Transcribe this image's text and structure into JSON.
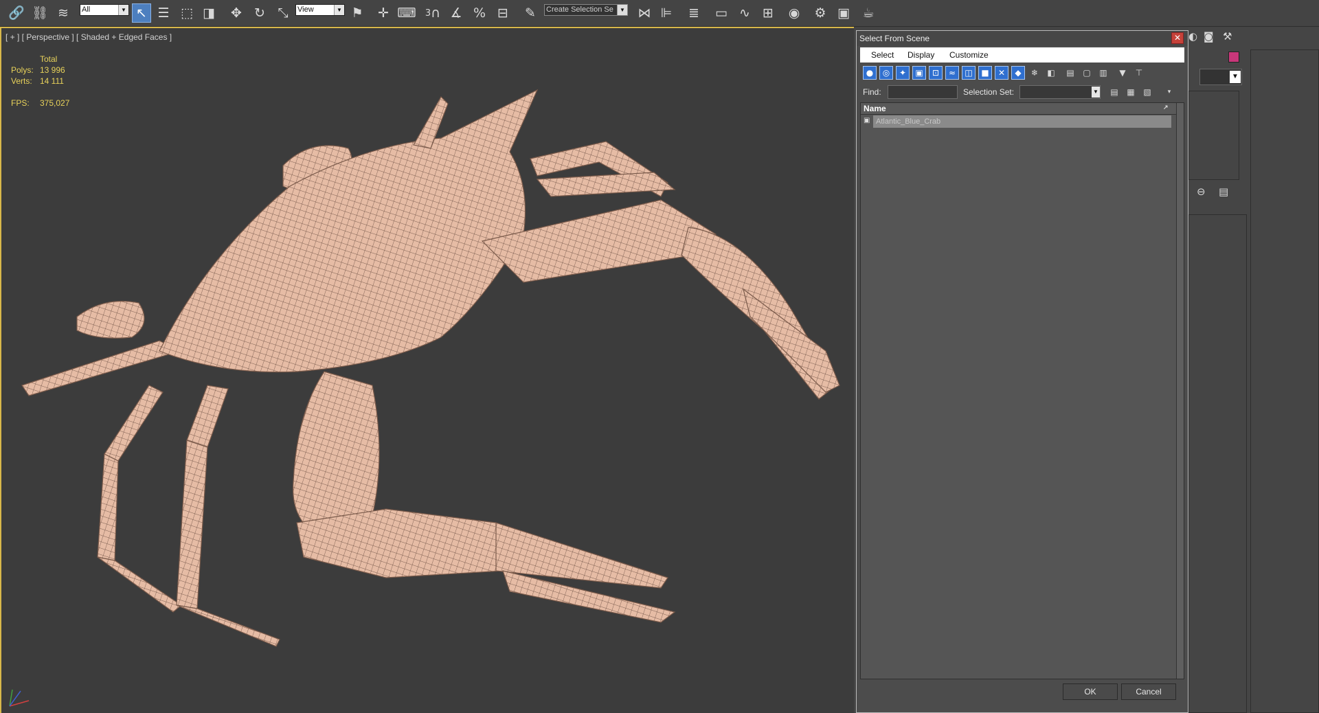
{
  "toolbar": {
    "selection_filter": "All",
    "reference_coord": "View",
    "named_selection_placeholder": "Create Selection Se",
    "snap_angle_label": "3",
    "icons": [
      "link-icon",
      "unlink-icon",
      "bind-space-warp-icon",
      "select-object-icon",
      "select-by-name-icon",
      "rect-selection-icon",
      "window-crossing-icon",
      "move-icon",
      "rotate-icon",
      "scale-icon",
      "select-manipulate-icon",
      "pivot-center-icon",
      "keyboard-shortcut-icon",
      "snaps-toggle-icon",
      "angle-snap-icon",
      "percent-snap-icon",
      "spinner-snap-icon",
      "edit-named-selection-icon",
      "mirror-icon",
      "align-icon",
      "layer-manager-icon",
      "toggle-ribbon-icon",
      "curve-editor-icon",
      "schematic-view-icon",
      "material-editor-icon",
      "render-setup-icon",
      "rendered-frame-icon",
      "render-icon"
    ]
  },
  "viewport": {
    "label": "[ + ] [ Perspective ] [ Shaded + Edged Faces ]",
    "stats": {
      "header": "Total",
      "polys_label": "Polys:",
      "polys_value": "13 996",
      "verts_label": "Verts:",
      "verts_value": "14 111",
      "fps_label": "FPS:",
      "fps_value": "375,027"
    }
  },
  "dialog": {
    "title": "Select From Scene",
    "close_label": "✕",
    "menu": [
      "Select",
      "Display",
      "Customize"
    ],
    "find_label": "Find:",
    "find_value": "",
    "selection_set_label": "Selection Set:",
    "selection_set_value": "",
    "list_header": "Name",
    "objects": [
      "Atlantic_Blue_Crab"
    ],
    "ok_label": "OK",
    "cancel_label": "Cancel"
  },
  "colors": {
    "viewport_border": "#d8b84a",
    "stats_text": "#e8d25a",
    "mesh_fill": "#e6bca5",
    "mesh_wire": "#5a4035",
    "dialog_toolbar_blue": "#2f6fcf",
    "close_button": "#c6423a",
    "object_color_swatch": "#c8377a"
  }
}
